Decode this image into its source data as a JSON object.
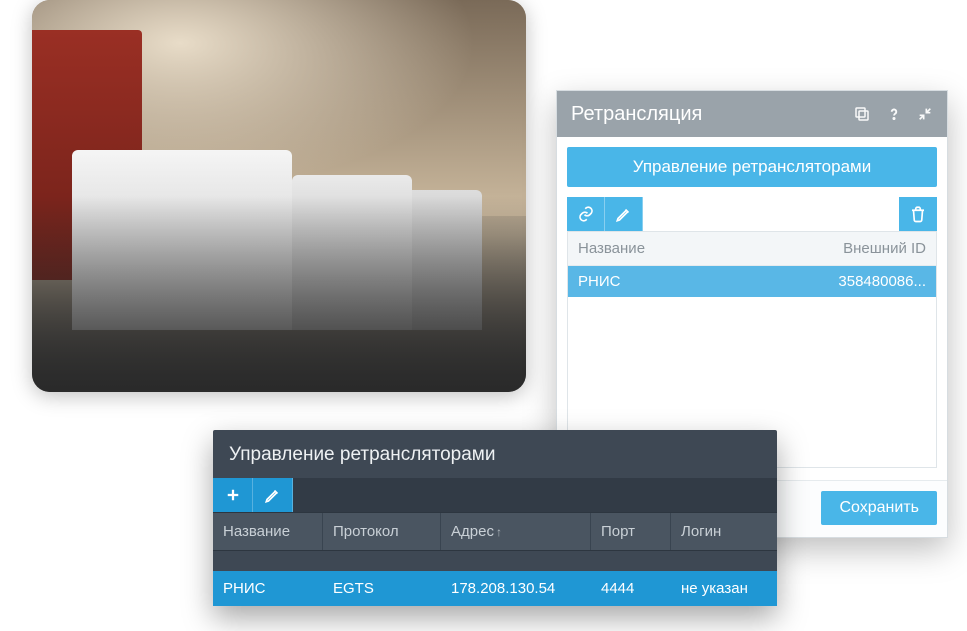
{
  "photo": {
    "alt": "Грузовики"
  },
  "light_panel": {
    "title": "Ретрансляция",
    "tab_label": "Управление ретрансляторами",
    "columns": {
      "name": "Название",
      "ext_id": "Внешний ID"
    },
    "rows": [
      {
        "name": "РНИС",
        "ext_id": "358480086..."
      }
    ],
    "save_label": "Сохранить"
  },
  "dark_panel": {
    "title": "Управление ретрансляторами",
    "columns": {
      "name": "Название",
      "protocol": "Протокол",
      "address": "Адрес",
      "port": "Порт",
      "login": "Логин"
    },
    "rows": [
      {
        "name": "РНИС",
        "protocol": "EGTS",
        "address": "178.208.130.54",
        "port": "4444",
        "login": "не указан"
      }
    ]
  }
}
